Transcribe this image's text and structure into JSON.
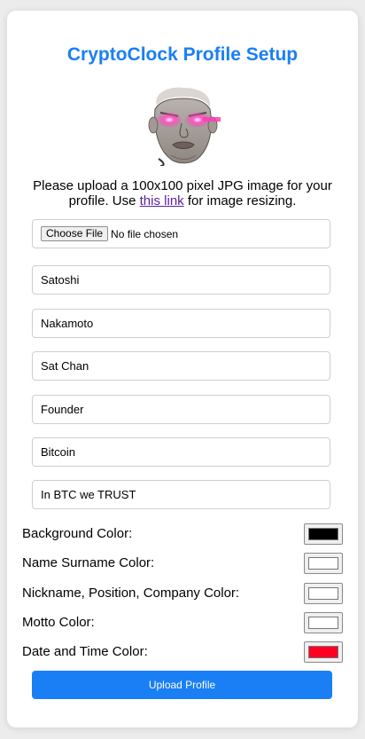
{
  "header": {
    "title": "CryptoClock Profile Setup"
  },
  "avatar": {
    "description_icon": "profile-avatar-image"
  },
  "instructions": {
    "before_link": "Please upload a 100x100 pixel JPG image for your profile. Use ",
    "link_text": "this link",
    "after_link": " for image resizing."
  },
  "file_input": {
    "button_label": "Choose File",
    "status": "No file chosen"
  },
  "fields": {
    "name": "Satoshi",
    "surname": "Nakamoto",
    "nickname": "Sat Chan",
    "position": "Founder",
    "company": "Bitcoin",
    "motto": "In BTC we TRUST"
  },
  "colors": [
    {
      "label": "Background Color:",
      "value": "#000000"
    },
    {
      "label": "Name Surname Color:",
      "value": "#ffffff"
    },
    {
      "label": "Nickname, Position, Company Color:",
      "value": "#ffffff"
    },
    {
      "label": "Motto Color:",
      "value": "#ffffff"
    },
    {
      "label": "Date and Time Color:",
      "value": "#ff0022"
    }
  ],
  "upload_button": {
    "label": "Upload Profile"
  },
  "theme": {
    "accent": "#1a7ff5",
    "link": "#5a1fa0"
  }
}
